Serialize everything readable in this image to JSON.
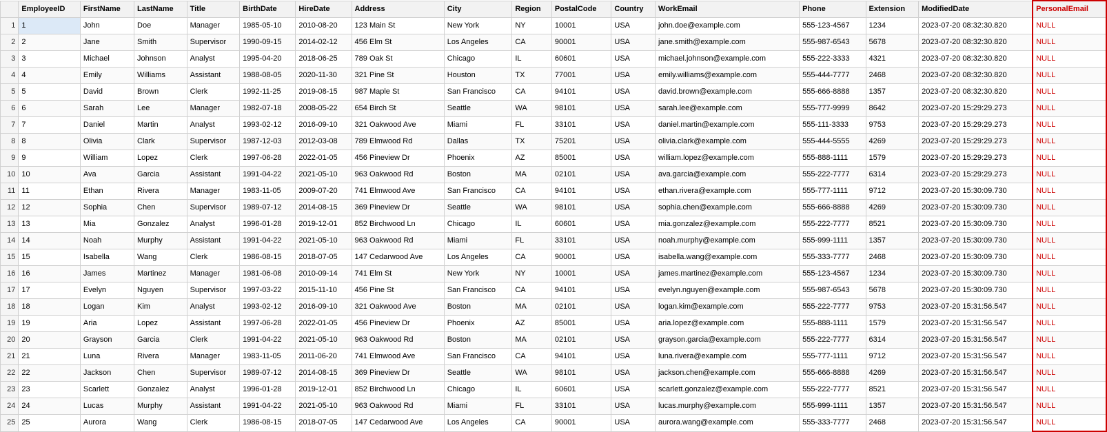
{
  "columns": [
    {
      "id": "row-num",
      "label": ""
    },
    {
      "id": "EmployeeID",
      "label": "EmployeeID"
    },
    {
      "id": "FirstName",
      "label": "FirstName"
    },
    {
      "id": "LastName",
      "label": "LastName"
    },
    {
      "id": "Title",
      "label": "Title"
    },
    {
      "id": "BirthDate",
      "label": "BirthDate"
    },
    {
      "id": "HireDate",
      "label": "HireDate"
    },
    {
      "id": "Address",
      "label": "Address"
    },
    {
      "id": "City",
      "label": "City"
    },
    {
      "id": "Region",
      "label": "Region"
    },
    {
      "id": "PostalCode",
      "label": "PostalCode"
    },
    {
      "id": "Country",
      "label": "Country"
    },
    {
      "id": "WorkEmail",
      "label": "WorkEmail"
    },
    {
      "id": "Phone",
      "label": "Phone"
    },
    {
      "id": "Extension",
      "label": "Extension"
    },
    {
      "id": "ModifiedDate",
      "label": "ModifiedDate"
    },
    {
      "id": "PersonalEmail",
      "label": "PersonalEmail"
    }
  ],
  "rows": [
    {
      "row": 1,
      "EmployeeID": "1",
      "FirstName": "John",
      "LastName": "Doe",
      "Title": "Manager",
      "BirthDate": "1985-05-10",
      "HireDate": "2010-08-20",
      "Address": "123 Main St",
      "City": "New York",
      "Region": "NY",
      "PostalCode": "10001",
      "Country": "USA",
      "WorkEmail": "john.doe@example.com",
      "Phone": "555-123-4567",
      "Extension": "1234",
      "ModifiedDate": "2023-07-20 08:32:30.820",
      "PersonalEmail": "NULL",
      "selected": true
    },
    {
      "row": 2,
      "EmployeeID": "2",
      "FirstName": "Jane",
      "LastName": "Smith",
      "Title": "Supervisor",
      "BirthDate": "1990-09-15",
      "HireDate": "2014-02-12",
      "Address": "456 Elm St",
      "City": "Los Angeles",
      "Region": "CA",
      "PostalCode": "90001",
      "Country": "USA",
      "WorkEmail": "jane.smith@example.com",
      "Phone": "555-987-6543",
      "Extension": "5678",
      "ModifiedDate": "2023-07-20 08:32:30.820",
      "PersonalEmail": "NULL"
    },
    {
      "row": 3,
      "EmployeeID": "3",
      "FirstName": "Michael",
      "LastName": "Johnson",
      "Title": "Analyst",
      "BirthDate": "1995-04-20",
      "HireDate": "2018-06-25",
      "Address": "789 Oak St",
      "City": "Chicago",
      "Region": "IL",
      "PostalCode": "60601",
      "Country": "USA",
      "WorkEmail": "michael.johnson@example.com",
      "Phone": "555-222-3333",
      "Extension": "4321",
      "ModifiedDate": "2023-07-20 08:32:30.820",
      "PersonalEmail": "NULL"
    },
    {
      "row": 4,
      "EmployeeID": "4",
      "FirstName": "Emily",
      "LastName": "Williams",
      "Title": "Assistant",
      "BirthDate": "1988-08-05",
      "HireDate": "2020-11-30",
      "Address": "321 Pine St",
      "City": "Houston",
      "Region": "TX",
      "PostalCode": "77001",
      "Country": "USA",
      "WorkEmail": "emily.williams@example.com",
      "Phone": "555-444-7777",
      "Extension": "2468",
      "ModifiedDate": "2023-07-20 08:32:30.820",
      "PersonalEmail": "NULL"
    },
    {
      "row": 5,
      "EmployeeID": "5",
      "FirstName": "David",
      "LastName": "Brown",
      "Title": "Clerk",
      "BirthDate": "1992-11-25",
      "HireDate": "2019-08-15",
      "Address": "987 Maple St",
      "City": "San Francisco",
      "Region": "CA",
      "PostalCode": "94101",
      "Country": "USA",
      "WorkEmail": "david.brown@example.com",
      "Phone": "555-666-8888",
      "Extension": "1357",
      "ModifiedDate": "2023-07-20 08:32:30.820",
      "PersonalEmail": "NULL"
    },
    {
      "row": 6,
      "EmployeeID": "6",
      "FirstName": "Sarah",
      "LastName": "Lee",
      "Title": "Manager",
      "BirthDate": "1982-07-18",
      "HireDate": "2008-05-22",
      "Address": "654 Birch St",
      "City": "Seattle",
      "Region": "WA",
      "PostalCode": "98101",
      "Country": "USA",
      "WorkEmail": "sarah.lee@example.com",
      "Phone": "555-777-9999",
      "Extension": "8642",
      "ModifiedDate": "2023-07-20 15:29:29.273",
      "PersonalEmail": "NULL"
    },
    {
      "row": 7,
      "EmployeeID": "7",
      "FirstName": "Daniel",
      "LastName": "Martin",
      "Title": "Analyst",
      "BirthDate": "1993-02-12",
      "HireDate": "2016-09-10",
      "Address": "321 Oakwood Ave",
      "City": "Miami",
      "Region": "FL",
      "PostalCode": "33101",
      "Country": "USA",
      "WorkEmail": "daniel.martin@example.com",
      "Phone": "555-111-3333",
      "Extension": "9753",
      "ModifiedDate": "2023-07-20 15:29:29.273",
      "PersonalEmail": "NULL"
    },
    {
      "row": 8,
      "EmployeeID": "8",
      "FirstName": "Olivia",
      "LastName": "Clark",
      "Title": "Supervisor",
      "BirthDate": "1987-12-03",
      "HireDate": "2012-03-08",
      "Address": "789 Elmwood Rd",
      "City": "Dallas",
      "Region": "TX",
      "PostalCode": "75201",
      "Country": "USA",
      "WorkEmail": "olivia.clark@example.com",
      "Phone": "555-444-5555",
      "Extension": "4269",
      "ModifiedDate": "2023-07-20 15:29:29.273",
      "PersonalEmail": "NULL"
    },
    {
      "row": 9,
      "EmployeeID": "9",
      "FirstName": "William",
      "LastName": "Lopez",
      "Title": "Clerk",
      "BirthDate": "1997-06-28",
      "HireDate": "2022-01-05",
      "Address": "456 Pineview Dr",
      "City": "Phoenix",
      "Region": "AZ",
      "PostalCode": "85001",
      "Country": "USA",
      "WorkEmail": "william.lopez@example.com",
      "Phone": "555-888-1111",
      "Extension": "1579",
      "ModifiedDate": "2023-07-20 15:29:29.273",
      "PersonalEmail": "NULL"
    },
    {
      "row": 10,
      "EmployeeID": "10",
      "FirstName": "Ava",
      "LastName": "Garcia",
      "Title": "Assistant",
      "BirthDate": "1991-04-22",
      "HireDate": "2021-05-10",
      "Address": "963 Oakwood Rd",
      "City": "Boston",
      "Region": "MA",
      "PostalCode": "02101",
      "Country": "USA",
      "WorkEmail": "ava.garcia@example.com",
      "Phone": "555-222-7777",
      "Extension": "6314",
      "ModifiedDate": "2023-07-20 15:29:29.273",
      "PersonalEmail": "NULL"
    },
    {
      "row": 11,
      "EmployeeID": "11",
      "FirstName": "Ethan",
      "LastName": "Rivera",
      "Title": "Manager",
      "BirthDate": "1983-11-05",
      "HireDate": "2009-07-20",
      "Address": "741 Elmwood Ave",
      "City": "San Francisco",
      "Region": "CA",
      "PostalCode": "94101",
      "Country": "USA",
      "WorkEmail": "ethan.rivera@example.com",
      "Phone": "555-777-1111",
      "Extension": "9712",
      "ModifiedDate": "2023-07-20 15:30:09.730",
      "PersonalEmail": "NULL"
    },
    {
      "row": 12,
      "EmployeeID": "12",
      "FirstName": "Sophia",
      "LastName": "Chen",
      "Title": "Supervisor",
      "BirthDate": "1989-07-12",
      "HireDate": "2014-08-15",
      "Address": "369 Pineview Dr",
      "City": "Seattle",
      "Region": "WA",
      "PostalCode": "98101",
      "Country": "USA",
      "WorkEmail": "sophia.chen@example.com",
      "Phone": "555-666-8888",
      "Extension": "4269",
      "ModifiedDate": "2023-07-20 15:30:09.730",
      "PersonalEmail": "NULL"
    },
    {
      "row": 13,
      "EmployeeID": "13",
      "FirstName": "Mia",
      "LastName": "Gonzalez",
      "Title": "Analyst",
      "BirthDate": "1996-01-28",
      "HireDate": "2019-12-01",
      "Address": "852 Birchwood Ln",
      "City": "Chicago",
      "Region": "IL",
      "PostalCode": "60601",
      "Country": "USA",
      "WorkEmail": "mia.gonzalez@example.com",
      "Phone": "555-222-7777",
      "Extension": "8521",
      "ModifiedDate": "2023-07-20 15:30:09.730",
      "PersonalEmail": "NULL"
    },
    {
      "row": 14,
      "EmployeeID": "14",
      "FirstName": "Noah",
      "LastName": "Murphy",
      "Title": "Assistant",
      "BirthDate": "1991-04-22",
      "HireDate": "2021-05-10",
      "Address": "963 Oakwood Rd",
      "City": "Miami",
      "Region": "FL",
      "PostalCode": "33101",
      "Country": "USA",
      "WorkEmail": "noah.murphy@example.com",
      "Phone": "555-999-1111",
      "Extension": "1357",
      "ModifiedDate": "2023-07-20 15:30:09.730",
      "PersonalEmail": "NULL"
    },
    {
      "row": 15,
      "EmployeeID": "15",
      "FirstName": "Isabella",
      "LastName": "Wang",
      "Title": "Clerk",
      "BirthDate": "1986-08-15",
      "HireDate": "2018-07-05",
      "Address": "147 Cedarwood Ave",
      "City": "Los Angeles",
      "Region": "CA",
      "PostalCode": "90001",
      "Country": "USA",
      "WorkEmail": "isabella.wang@example.com",
      "Phone": "555-333-7777",
      "Extension": "2468",
      "ModifiedDate": "2023-07-20 15:30:09.730",
      "PersonalEmail": "NULL"
    },
    {
      "row": 16,
      "EmployeeID": "16",
      "FirstName": "James",
      "LastName": "Martinez",
      "Title": "Manager",
      "BirthDate": "1981-06-08",
      "HireDate": "2010-09-14",
      "Address": "741 Elm St",
      "City": "New York",
      "Region": "NY",
      "PostalCode": "10001",
      "Country": "USA",
      "WorkEmail": "james.martinez@example.com",
      "Phone": "555-123-4567",
      "Extension": "1234",
      "ModifiedDate": "2023-07-20 15:30:09.730",
      "PersonalEmail": "NULL"
    },
    {
      "row": 17,
      "EmployeeID": "17",
      "FirstName": "Evelyn",
      "LastName": "Nguyen",
      "Title": "Supervisor",
      "BirthDate": "1997-03-22",
      "HireDate": "2015-11-10",
      "Address": "456 Pine St",
      "City": "San Francisco",
      "Region": "CA",
      "PostalCode": "94101",
      "Country": "USA",
      "WorkEmail": "evelyn.nguyen@example.com",
      "Phone": "555-987-6543",
      "Extension": "5678",
      "ModifiedDate": "2023-07-20 15:30:09.730",
      "PersonalEmail": "NULL"
    },
    {
      "row": 18,
      "EmployeeID": "18",
      "FirstName": "Logan",
      "LastName": "Kim",
      "Title": "Analyst",
      "BirthDate": "1993-02-12",
      "HireDate": "2016-09-10",
      "Address": "321 Oakwood Ave",
      "City": "Boston",
      "Region": "MA",
      "PostalCode": "02101",
      "Country": "USA",
      "WorkEmail": "logan.kim@example.com",
      "Phone": "555-222-7777",
      "Extension": "9753",
      "ModifiedDate": "2023-07-20 15:31:56.547",
      "PersonalEmail": "NULL"
    },
    {
      "row": 19,
      "EmployeeID": "19",
      "FirstName": "Aria",
      "LastName": "Lopez",
      "Title": "Assistant",
      "BirthDate": "1997-06-28",
      "HireDate": "2022-01-05",
      "Address": "456 Pineview Dr",
      "City": "Phoenix",
      "Region": "AZ",
      "PostalCode": "85001",
      "Country": "USA",
      "WorkEmail": "aria.lopez@example.com",
      "Phone": "555-888-1111",
      "Extension": "1579",
      "ModifiedDate": "2023-07-20 15:31:56.547",
      "PersonalEmail": "NULL"
    },
    {
      "row": 20,
      "EmployeeID": "20",
      "FirstName": "Grayson",
      "LastName": "Garcia",
      "Title": "Clerk",
      "BirthDate": "1991-04-22",
      "HireDate": "2021-05-10",
      "Address": "963 Oakwood Rd",
      "City": "Boston",
      "Region": "MA",
      "PostalCode": "02101",
      "Country": "USA",
      "WorkEmail": "grayson.garcia@example.com",
      "Phone": "555-222-7777",
      "Extension": "6314",
      "ModifiedDate": "2023-07-20 15:31:56.547",
      "PersonalEmail": "NULL"
    },
    {
      "row": 21,
      "EmployeeID": "21",
      "FirstName": "Luna",
      "LastName": "Rivera",
      "Title": "Manager",
      "BirthDate": "1983-11-05",
      "HireDate": "2011-06-20",
      "Address": "741 Elmwood Ave",
      "City": "San Francisco",
      "Region": "CA",
      "PostalCode": "94101",
      "Country": "USA",
      "WorkEmail": "luna.rivera@example.com",
      "Phone": "555-777-1111",
      "Extension": "9712",
      "ModifiedDate": "2023-07-20 15:31:56.547",
      "PersonalEmail": "NULL"
    },
    {
      "row": 22,
      "EmployeeID": "22",
      "FirstName": "Jackson",
      "LastName": "Chen",
      "Title": "Supervisor",
      "BirthDate": "1989-07-12",
      "HireDate": "2014-08-15",
      "Address": "369 Pineview Dr",
      "City": "Seattle",
      "Region": "WA",
      "PostalCode": "98101",
      "Country": "USA",
      "WorkEmail": "jackson.chen@example.com",
      "Phone": "555-666-8888",
      "Extension": "4269",
      "ModifiedDate": "2023-07-20 15:31:56.547",
      "PersonalEmail": "NULL"
    },
    {
      "row": 23,
      "EmployeeID": "23",
      "FirstName": "Scarlett",
      "LastName": "Gonzalez",
      "Title": "Analyst",
      "BirthDate": "1996-01-28",
      "HireDate": "2019-12-01",
      "Address": "852 Birchwood Ln",
      "City": "Chicago",
      "Region": "IL",
      "PostalCode": "60601",
      "Country": "USA",
      "WorkEmail": "scarlett.gonzalez@example.com",
      "Phone": "555-222-7777",
      "Extension": "8521",
      "ModifiedDate": "2023-07-20 15:31:56.547",
      "PersonalEmail": "NULL"
    },
    {
      "row": 24,
      "EmployeeID": "24",
      "FirstName": "Lucas",
      "LastName": "Murphy",
      "Title": "Assistant",
      "BirthDate": "1991-04-22",
      "HireDate": "2021-05-10",
      "Address": "963 Oakwood Rd",
      "City": "Miami",
      "Region": "FL",
      "PostalCode": "33101",
      "Country": "USA",
      "WorkEmail": "lucas.murphy@example.com",
      "Phone": "555-999-1111",
      "Extension": "1357",
      "ModifiedDate": "2023-07-20 15:31:56.547",
      "PersonalEmail": "NULL"
    },
    {
      "row": 25,
      "EmployeeID": "25",
      "FirstName": "Aurora",
      "LastName": "Wang",
      "Title": "Clerk",
      "BirthDate": "1986-08-15",
      "HireDate": "2018-07-05",
      "Address": "147 Cedarwood Ave",
      "City": "Los Angeles",
      "Region": "CA",
      "PostalCode": "90001",
      "Country": "USA",
      "WorkEmail": "aurora.wang@example.com",
      "Phone": "555-333-7777",
      "Extension": "2468",
      "ModifiedDate": "2023-07-20 15:31:56.547",
      "PersonalEmail": "NULL"
    }
  ]
}
